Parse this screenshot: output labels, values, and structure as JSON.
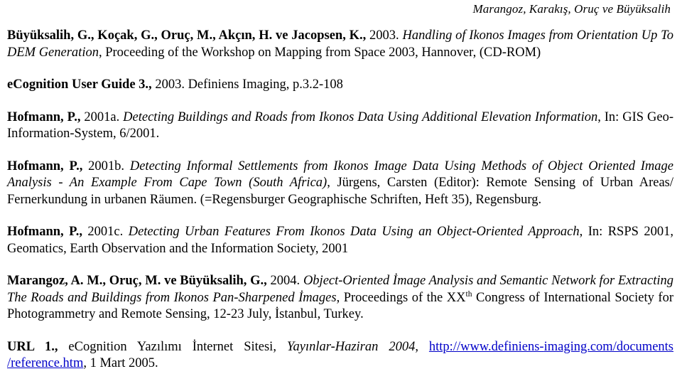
{
  "header": {
    "running_title": "Marangoz, Karakış, Oruç ve Büyüksalih"
  },
  "references": [
    {
      "id": "buyuksalih-2003",
      "authors": "Büyüksalih, G., Koçak, G., Oruç, M., Akçın, H. ve Jacopsen, K.,",
      "year": " 2003. ",
      "title": "Handling of Ikonos Images from Orientation Up To DEM Generation",
      "rest": ", Proceeding of the Workshop on Mapping from Space 2003, Hannover, (CD-ROM)"
    },
    {
      "id": "ecognition-user-guide-3",
      "authors": "eCognition User Guide 3.,",
      "year": " 2003. ",
      "title": "",
      "rest": "Definiens Imaging, p.3.2-108"
    },
    {
      "id": "hofmann-2001a",
      "authors": "Hofmann, P.,",
      "year": " 2001a. ",
      "title": "Detecting Buildings and Roads from Ikonos Data Using Additional Elevation Information",
      "rest": ", In: GIS Geo-Information-System, 6/2001."
    },
    {
      "id": "hofmann-2001b",
      "authors": "Hofmann, P.,",
      "year": " 2001b. ",
      "title": "Detecting Informal Settlements from Ikonos Image Data Using Methods of Object Oriented Image Analysis - An Example From Cape Town (South Africa)",
      "rest": ", Jürgens, Carsten (Editor): Remote Sensing of Urban Areas/ Fernerkundung in urbanen Räumen. (=Regensburger Geographische Schriften, Heft 35), Regensburg."
    },
    {
      "id": "hofmann-2001c",
      "authors": "Hofmann, P.,",
      "year": " 2001c. ",
      "title": "Detecting Urban Features From Ikonos Data Using an Object-Oriented Approach",
      "rest": ", In: RSPS 2001, Geomatics, Earth Observation and the Information Society, 2001"
    },
    {
      "id": "marangoz-2004",
      "authors": "Marangoz, A. M., Oruç, M. ve Büyüksalih, G.,",
      "year": " 2004. ",
      "title": "Object-Oriented İmage Analysis and Semantic Network for Extracting The Roads and Buildings from Ikonos Pan-Sharpened İmages",
      "rest_pre": ", Proceedings of the XX",
      "superscript": "th",
      "rest_post": " Congress of International Society for Photogrammetry and Remote Sensing, 12-23 July, İstanbul, Turkey."
    }
  ],
  "url_entry": {
    "id": "url-1",
    "label": "URL 1.,",
    "description": " eCognition Yazılımı İnternet Sitesi, ",
    "italic_part": "Yayınlar-Haziran 2004",
    "separator": ", ",
    "link_line1": "http://www.definiens-",
    "link_line2": "imaging.com/documents /reference.htm",
    "date_suffix": ", 1 Mart 2005."
  },
  "colors": {
    "link": "#0000c8",
    "text": "#000000",
    "background": "#ffffff"
  }
}
